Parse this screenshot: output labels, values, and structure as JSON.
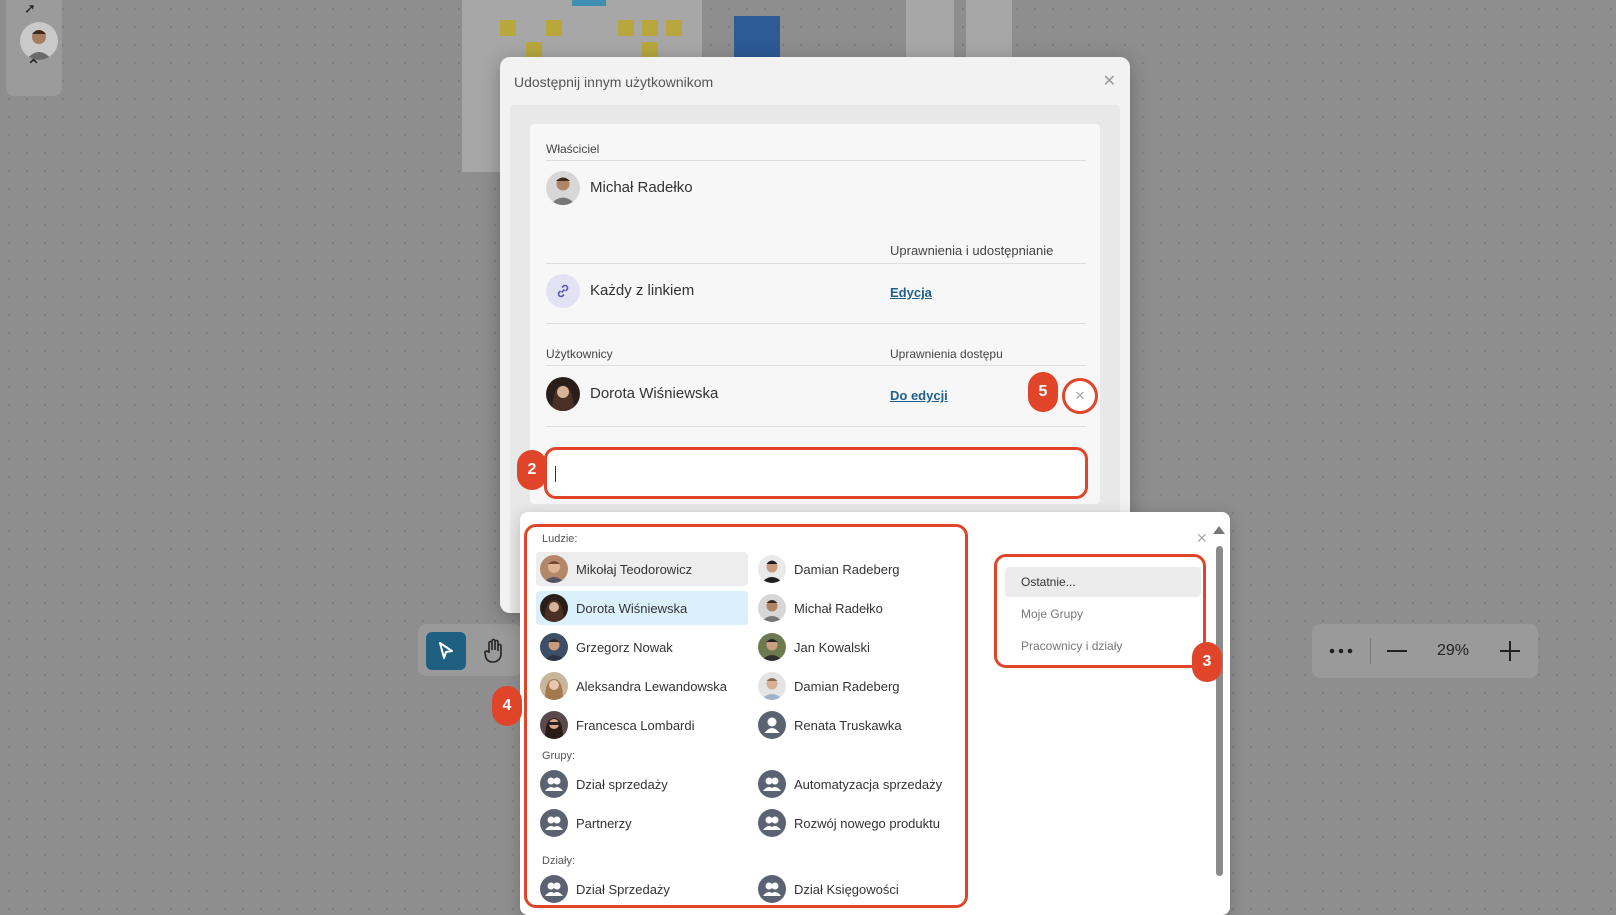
{
  "dialog": {
    "title": "Udostępnij innym użytkownikom",
    "owner_label": "Właściciel",
    "owner_name": "Michał Radełko",
    "sharing_header": "Uprawnienia i udostępnianie",
    "link_label": "Każdy z linkiem",
    "link_permission": "Edycja",
    "users_label": "Użytkownicy",
    "access_header": "Uprawnienia dostępu",
    "user_name": "Dorota Wiśniewska",
    "user_permission": "Do edycji",
    "search_value": ""
  },
  "dropdown": {
    "people_label": "Ludzie:",
    "people_left": [
      {
        "name": "Mikołaj Teodorowicz",
        "state": "hover"
      },
      {
        "name": "Dorota Wiśniewska",
        "state": "selected"
      },
      {
        "name": "Grzegorz Nowak",
        "state": ""
      },
      {
        "name": "Aleksandra Lewandowska",
        "state": ""
      },
      {
        "name": "Francesca Lombardi",
        "state": ""
      }
    ],
    "people_right": [
      {
        "name": "Damian Radeberg"
      },
      {
        "name": "Michał Radełko"
      },
      {
        "name": "Jan Kowalski"
      },
      {
        "name": "Damian Radeberg"
      },
      {
        "name": "Renata Truskawka"
      }
    ],
    "groups_label": "Grupy:",
    "groups": [
      "Dział sprzedaży",
      "Automatyzacja sprzedaży",
      "Partnerzy",
      "Rozwój nowego produktu"
    ],
    "departments_label": "Działy:",
    "departments": [
      "Dział Sprzedaży",
      "Dział Księgowości"
    ],
    "filters": [
      "Ostatnie...",
      "Moje Grupy",
      "Pracownicy i działy"
    ]
  },
  "zoom": {
    "value": "29%"
  },
  "badges": {
    "two": "2",
    "three": "3",
    "four": "4",
    "five": "5"
  },
  "colors": {
    "accent": "#e0452a",
    "link": "#1f5f8f",
    "selected_row": "#daf0fb",
    "tool_active": "#1f5f82"
  },
  "icons": [
    "cursor-icon",
    "hand-icon",
    "link-icon",
    "close-icon",
    "group-icon",
    "user-icon",
    "more-icon",
    "minus-icon",
    "plus-icon",
    "chevron-up-icon"
  ]
}
